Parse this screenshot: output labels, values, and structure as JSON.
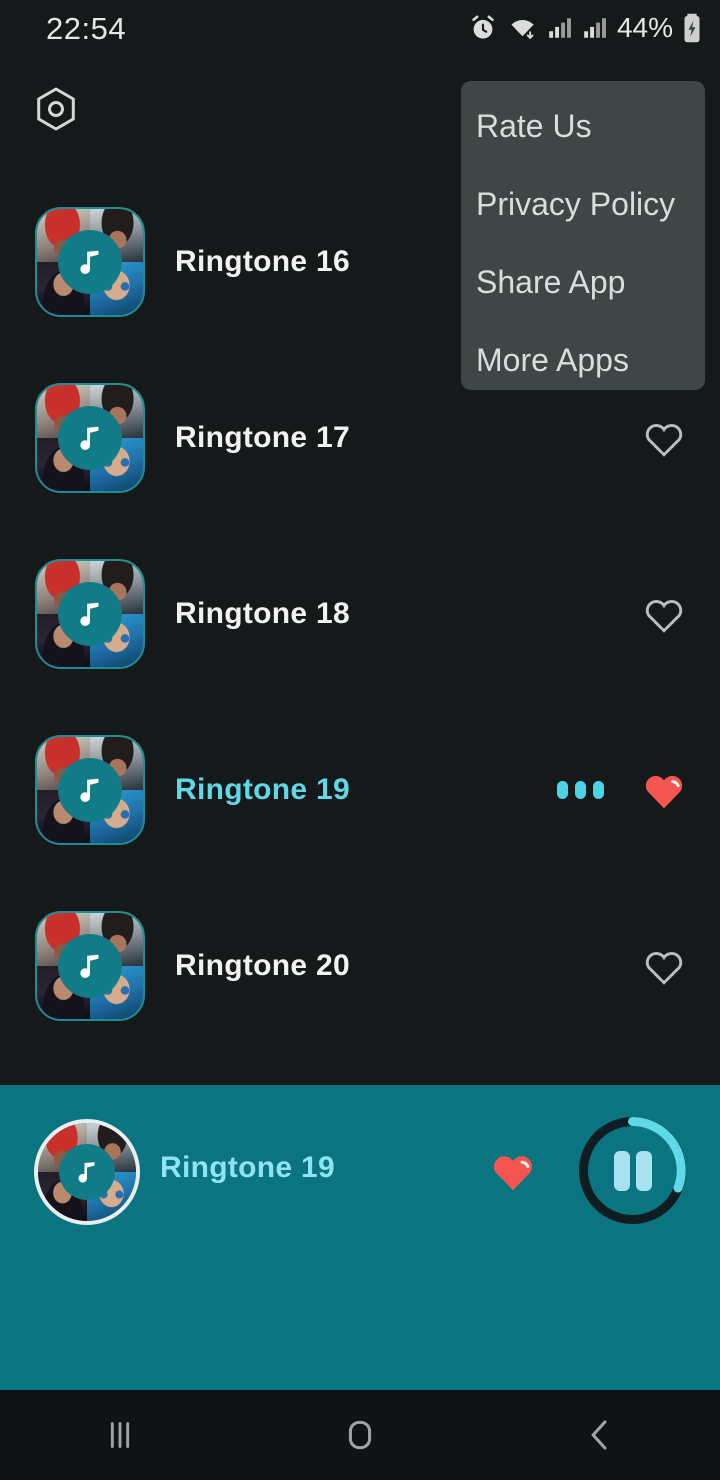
{
  "status_bar": {
    "time": "22:54",
    "battery_text": "44%",
    "icons": [
      "alarm-icon",
      "wifi-icon",
      "signal-icon",
      "signal-icon",
      "battery-charging-icon"
    ]
  },
  "top_bar": {
    "menu_icon": "hexagon-settings-icon"
  },
  "overflow_menu": {
    "visible": true,
    "background_color": "#3e4746",
    "items": [
      {
        "label": "Rate Us"
      },
      {
        "label": "Privacy Policy"
      },
      {
        "label": "Share App"
      },
      {
        "label": "More Apps"
      }
    ]
  },
  "list": {
    "rows": [
      {
        "title": "Ringtone 16",
        "favorite": false,
        "playing": false,
        "heart_icon": "heart-outline-icon"
      },
      {
        "title": "Ringtone 17",
        "favorite": false,
        "playing": false,
        "heart_icon": "heart-outline-icon"
      },
      {
        "title": "Ringtone 18",
        "favorite": false,
        "playing": false,
        "heart_icon": "heart-outline-icon"
      },
      {
        "title": "Ringtone 19",
        "favorite": true,
        "playing": true,
        "heart_icon": "heart-filled-icon"
      },
      {
        "title": "Ringtone 20",
        "favorite": false,
        "playing": false,
        "heart_icon": "heart-outline-icon"
      }
    ]
  },
  "player": {
    "title": "Ringtone 19",
    "favorite": true,
    "heart_icon": "heart-filled-icon",
    "play_state": "paused-toggle",
    "control_icon": "pause-icon",
    "progress_percent": 34,
    "background_color": "#0a7480",
    "title_color": "#8fe3f2",
    "accent_color": "#5fd8e8",
    "heart_color": "#f4564f"
  },
  "nav_bar": {
    "buttons": [
      {
        "name": "recents",
        "icon": "recent-apps-icon"
      },
      {
        "name": "home",
        "icon": "home-icon"
      },
      {
        "name": "back",
        "icon": "back-chevron-icon"
      }
    ]
  },
  "theme": {
    "background": "#15191a",
    "text_primary": "#f2f2f2",
    "accent_cyan": "#5fd8e8",
    "teal": "#117c87",
    "heart_red": "#f4564f"
  }
}
